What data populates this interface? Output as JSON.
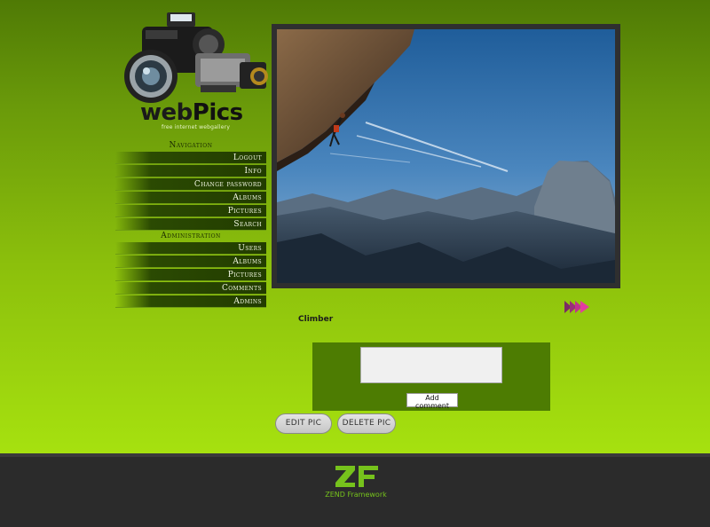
{
  "app": {
    "logo_web": "web",
    "logo_pics": "Pics",
    "tagline": "free internet webgallery"
  },
  "navigation": {
    "header": "Navigation",
    "items": [
      {
        "label": "Logout"
      },
      {
        "label": "Info"
      },
      {
        "label": "Change password"
      },
      {
        "label": "Albums"
      },
      {
        "label": "Pictures"
      },
      {
        "label": "Search"
      }
    ]
  },
  "administration": {
    "header": "Administration",
    "items": [
      {
        "label": "Users"
      },
      {
        "label": "Albums"
      },
      {
        "label": "Pictures"
      },
      {
        "label": "Comments"
      },
      {
        "label": "Admins"
      }
    ]
  },
  "picture": {
    "caption": "Climber"
  },
  "comment": {
    "value": "",
    "submit_label": "Add comment"
  },
  "actions": {
    "edit_label": "EDIT PIC",
    "delete_label": "DELETE PIC"
  },
  "footer": {
    "framework_label": "ZEND Framework"
  },
  "colors": {
    "accent_green": "#a6e10f",
    "nav_dark": "#223c00",
    "footer_bg": "#2b2b2b",
    "zend_green": "#76c21c"
  }
}
